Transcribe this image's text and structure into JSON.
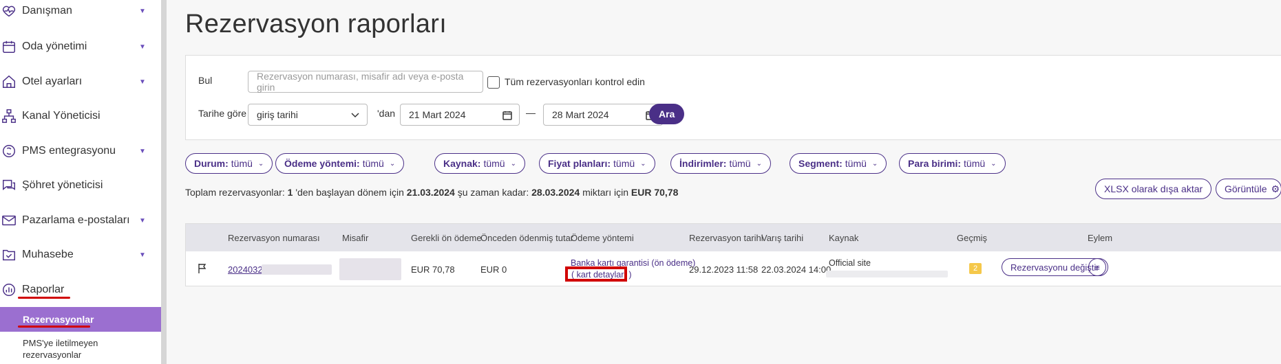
{
  "sidebar": {
    "items": [
      {
        "label": "Danışman",
        "icon": "heart-pulse-icon",
        "has_children": true
      },
      {
        "label": "Oda yönetimi",
        "icon": "calendar-icon",
        "has_children": true
      },
      {
        "label": "Otel ayarları",
        "icon": "home-icon",
        "has_children": true
      },
      {
        "label": "Kanal Yöneticisi",
        "icon": "network-icon",
        "has_children": false
      },
      {
        "label": "PMS entegrasyonu",
        "icon": "sync-icon",
        "has_children": true
      },
      {
        "label": "Şöhret yöneticisi",
        "icon": "chat-bubbles-icon",
        "has_children": false
      },
      {
        "label": "Pazarlama e-postaları",
        "icon": "envelope-icon",
        "has_children": true
      },
      {
        "label": "Muhasebe",
        "icon": "folder-check-icon",
        "has_children": true
      },
      {
        "label": "Raporlar",
        "icon": "chart-circle-icon",
        "has_children": false
      }
    ],
    "active_sub": "Rezervasyonlar",
    "sub_item": "PMS'ye iletilmeyen rezervasyonlar"
  },
  "page": {
    "title": "Rezervasyon raporları"
  },
  "filters": {
    "find_label": "Bul",
    "search_placeholder": "Rezervasyon numarası, misafir adı veya e-posta girin",
    "check_all_label": "Tüm rezervasyonları kontrol edin",
    "date_by_label": "Tarihe göre",
    "date_type_value": "giriş tarihi",
    "from_label": "'dan",
    "date_from": "21 Mart 2024",
    "dash": "—",
    "date_to": "28 Mart 2024",
    "search_button": "Ara"
  },
  "chips": [
    {
      "key": "Durum:",
      "value": "tümü"
    },
    {
      "key": "Ödeme yöntemi:",
      "value": "tümü"
    },
    {
      "key": "Kaynak:",
      "value": "tümü"
    },
    {
      "key": "Fiyat planları:",
      "value": "tümü"
    },
    {
      "key": "İndirimler:",
      "value": "tümü"
    },
    {
      "key": "Segment:",
      "value": "tümü"
    },
    {
      "key": "Para birimi:",
      "value": "tümü"
    }
  ],
  "summary": {
    "prefix": "Toplam rezervasyonlar:",
    "count": "1",
    "t1": "'den başlayan dönem için",
    "start": "21.03.2024",
    "t2": "şu zaman kadar:",
    "end": "28.03.2024",
    "t3": "miktarı için",
    "amount": "EUR 70,78"
  },
  "actions": {
    "export": "XLSX olarak dışa aktar",
    "view": "Görüntüle"
  },
  "table": {
    "headers": [
      "Rezervasyon numarası",
      "Misafir",
      "Gerekli ön ödeme",
      "Önceden ödenmiş tutar",
      "Ödeme yöntemi",
      "Rezervasyon tarihi",
      "Varış tarihi",
      "Kaynak",
      "Geçmiş",
      "Eylem"
    ],
    "row": {
      "number": "20240322",
      "required_prepay": "EUR 70,78",
      "prepaid": "EUR 0",
      "payment_method": "Banka kartı garantisi (ön ödeme)",
      "card_details": "( kart detayları )",
      "booking_date": "29.12.2023 11:58",
      "arrival_date": "22.03.2024 14:00",
      "source": "Official site",
      "history_count": "2",
      "action_button": "Rezervasyonu değiştir"
    }
  },
  "colors": {
    "accent": "#4a2f87",
    "active_bg": "#9b6fd0",
    "highlight": "#d10000",
    "badge": "#f5c84a"
  }
}
